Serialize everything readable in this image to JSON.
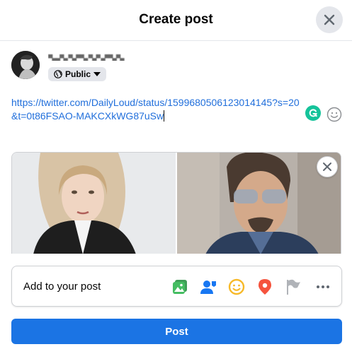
{
  "dialog": {
    "title": "Create post"
  },
  "user": {
    "name": "▀▄▄▀▄ ▀▄▀▀▄ ▀▄▀ ▄▀▀▄▀▄"
  },
  "privacy": {
    "label": "Public"
  },
  "post": {
    "text": "https://twitter.com/DailyLoud/status/1599680506123014145?s=20&t=0t86FSAO-MAKCXkWG87uSw"
  },
  "composer": {
    "add_to_post_label": "Add to your post",
    "post_button_label": "Post"
  },
  "icons": {
    "close": "close-icon",
    "globe": "globe-icon",
    "dropdown": "caret-down-icon",
    "grammarly": "grammarly-icon",
    "emoji": "emoji-icon",
    "remove_preview": "close-icon",
    "photo_video": "photo-video-icon",
    "tag_people": "tag-people-icon",
    "feeling": "feeling-icon",
    "check_in": "location-pin-icon",
    "life_event": "flag-icon",
    "more": "more-icon"
  },
  "colors": {
    "brand_blue": "#1b74e4",
    "link_blue": "#216fdb",
    "photo_green": "#45bd62",
    "tag_blue": "#1877f2",
    "feeling_yellow": "#f7b928",
    "location_red": "#f5533d",
    "flag_gray": "#b0b3b8",
    "grammarly_green": "#15c39a"
  }
}
